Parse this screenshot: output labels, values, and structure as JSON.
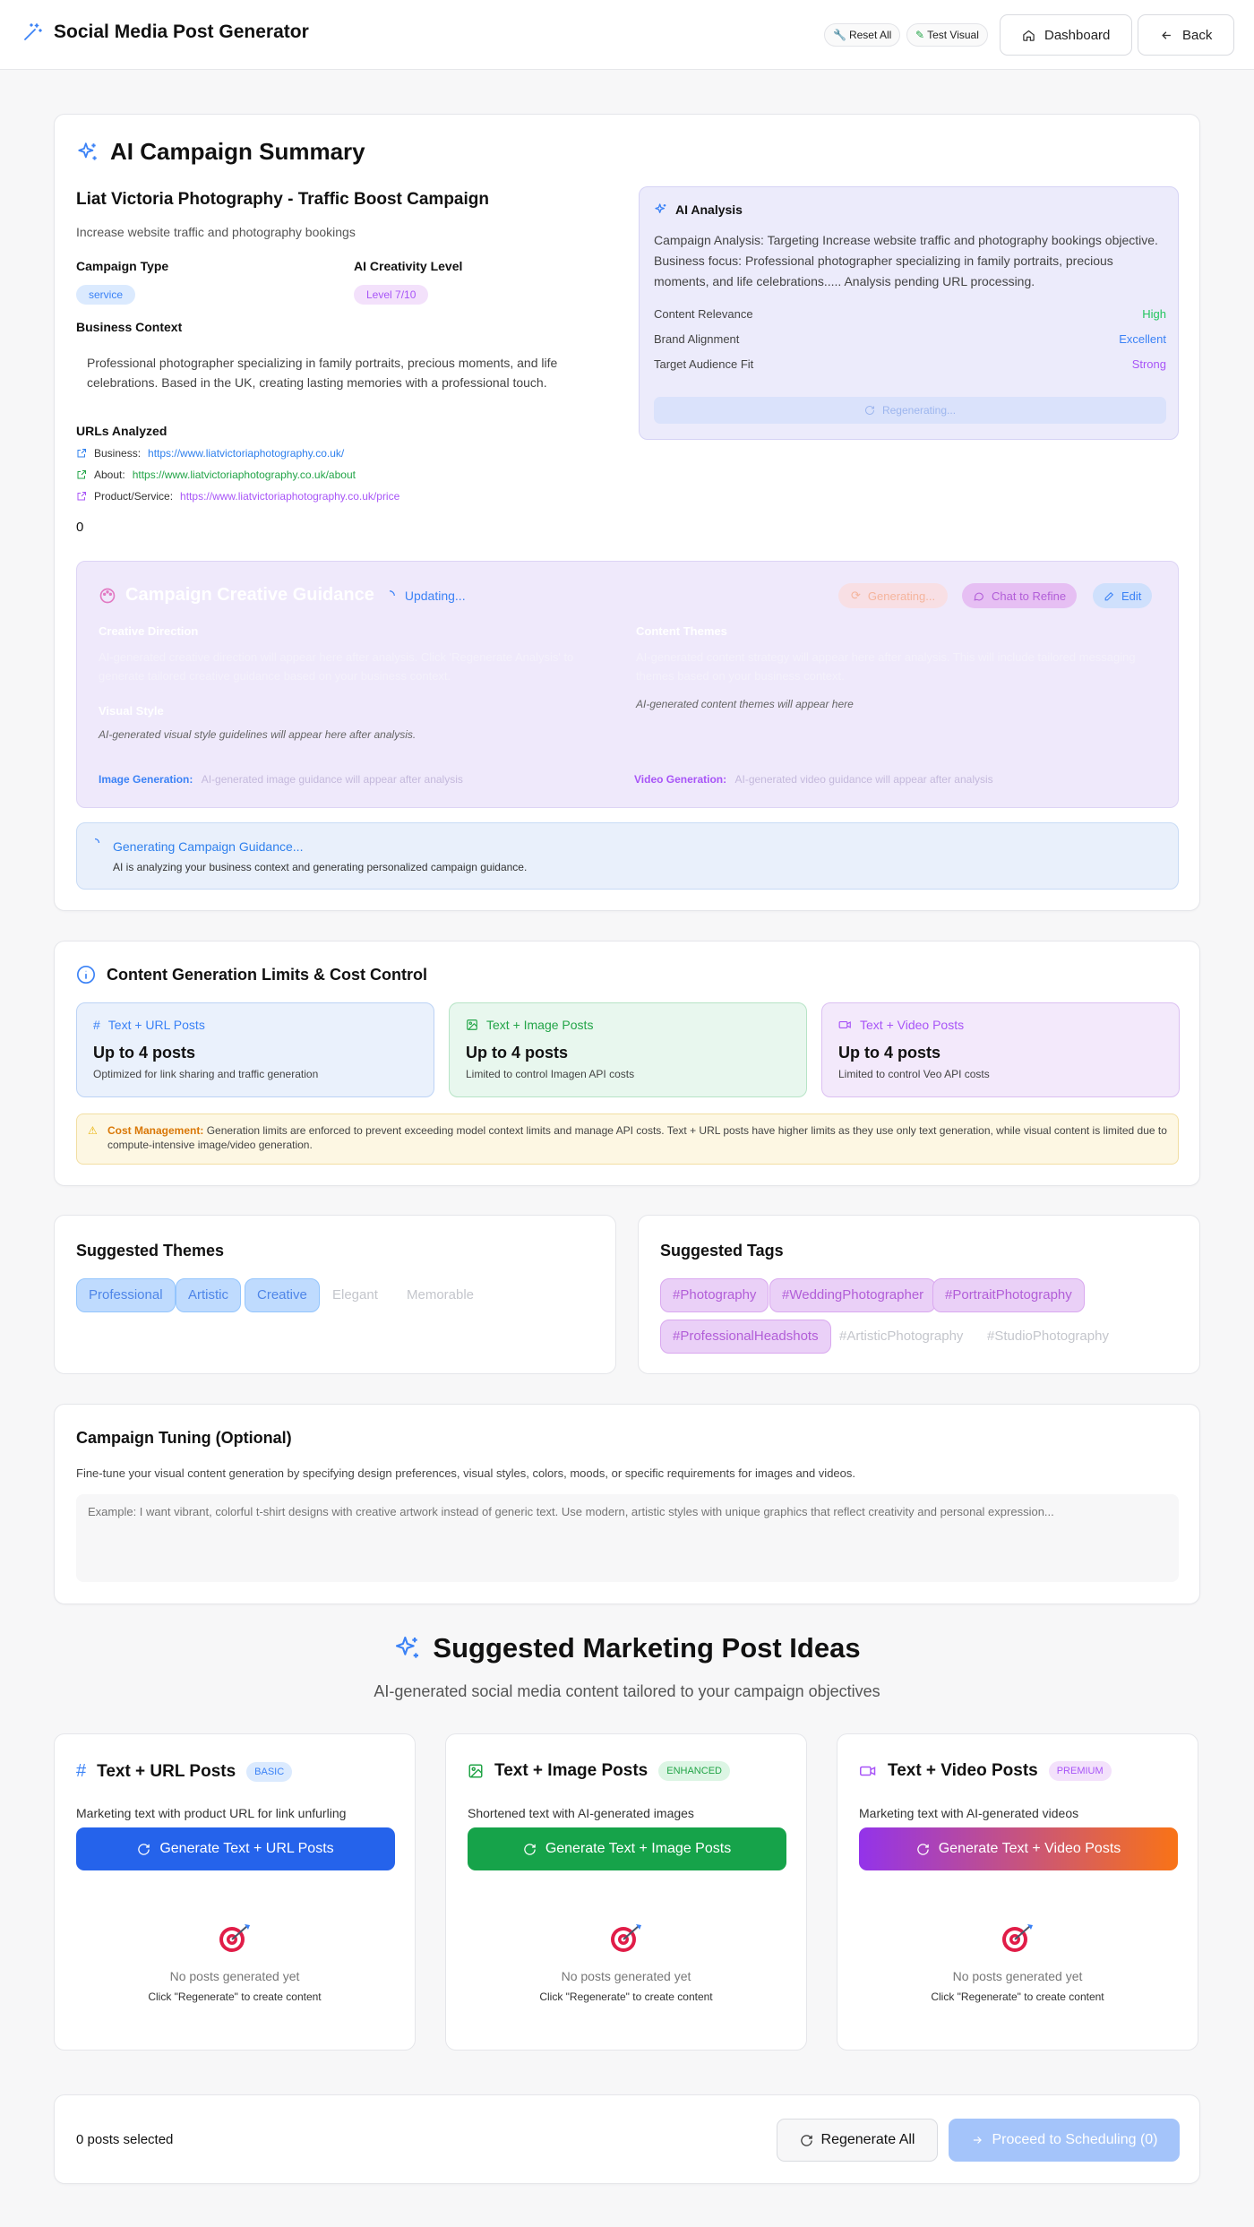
{
  "header": {
    "title": "Social Media Post Generator",
    "reset_label": "Reset All",
    "test_visual_label": "Test Visual",
    "dashboard_label": "Dashboard",
    "back_label": "Back"
  },
  "summary": {
    "title": "AI Campaign Summary",
    "campaign_name": "Liat Victoria Photography - Traffic Boost Campaign",
    "objective": "Increase website traffic and photography bookings",
    "campaign_type_label": "Campaign Type",
    "campaign_type_value": "service",
    "creativity_label": "AI Creativity Level",
    "creativity_value": "Level 7/10",
    "business_context_label": "Business Context",
    "business_context_text": "Professional photographer specializing in family portraits, precious moments, and life celebrations. Based in the UK, creating lasting memories with a professional touch.",
    "urls_label": "URLs Analyzed",
    "urls": [
      {
        "label": "Business:",
        "url": "https://www.liatvictoriaphotography.co.uk/",
        "color": "#2f80ed"
      },
      {
        "label": "About:",
        "url": "https://www.liatvictoriaphotography.co.uk/about",
        "color": "#22a447"
      },
      {
        "label": "Product/Service:",
        "url": "https://www.liatvictoriaphotography.co.uk/price",
        "color": "#a855f7"
      }
    ],
    "count": "0",
    "analysis": {
      "title": "AI Analysis",
      "text": "Campaign Analysis: Targeting Increase website traffic and photography bookings objective. Business focus: Professional photographer specializing in family portraits, precious moments, and life celebrations..... Analysis pending URL processing.",
      "metrics": [
        {
          "label": "Content Relevance",
          "value": "High",
          "color": "#22c55e"
        },
        {
          "label": "Brand Alignment",
          "value": "Excellent",
          "color": "#3b82f6"
        },
        {
          "label": "Target Audience Fit",
          "value": "Strong",
          "color": "#a855f7"
        }
      ],
      "regen_label": "Regenerating..."
    }
  },
  "guidance": {
    "title": "Campaign Creative Guidance",
    "updating": "Updating...",
    "generating_label": "Generating...",
    "chat_label": "Chat to Refine",
    "edit_label": "Edit",
    "creative_direction_title": "Creative Direction",
    "creative_direction_text": "AI-generated creative direction will appear here after analysis. Click 'Regenerate Analysis' to generate tailored creative guidance based on your business context.",
    "content_themes_title": "Content Themes",
    "content_themes_text": "AI-generated content strategy will appear here after analysis. This will include tailored messaging themes based on your business context.",
    "content_themes_placeholder": "AI-generated content themes will appear here",
    "visual_style_title": "Visual Style",
    "visual_style_text": "AI-generated visual style guidelines will appear here after analysis.",
    "image_gen_label": "Image Generation:",
    "image_gen_text": "AI-generated image guidance will appear after analysis",
    "video_gen_label": "Video Generation:",
    "video_gen_text": "AI-generated video guidance will appear after analysis",
    "status_title": "Generating Campaign Guidance...",
    "status_text": "AI is analyzing your business context and generating personalized campaign guidance."
  },
  "limits": {
    "title": "Content Generation Limits & Cost Control",
    "cards": [
      {
        "head": "Text + URL Posts",
        "title": "Up to 4 posts",
        "desc": "Optimized for link sharing and traffic generation"
      },
      {
        "head": "Text + Image Posts",
        "title": "Up to 4 posts",
        "desc": "Limited to control Imagen API costs"
      },
      {
        "head": "Text + Video Posts",
        "title": "Up to 4 posts",
        "desc": "Limited to control Veo API costs"
      }
    ],
    "notice_label": "Cost Management:",
    "notice_text": "Generation limits are enforced to prevent exceeding model context limits and manage API costs. Text + URL posts have higher limits as they use only text generation, while visual content is limited due to compute-intensive image/video generation."
  },
  "themes": {
    "title": "Suggested Themes",
    "items": [
      "Professional",
      "Artistic",
      "Creative",
      "Elegant",
      "Memorable"
    ]
  },
  "tags": {
    "title": "Suggested Tags",
    "items": [
      "#Photography",
      "#WeddingPhotographer",
      "#PortraitPhotography",
      "#ProfessionalHeadshots",
      "#ArtisticPhotography",
      "#StudioPhotography"
    ]
  },
  "tuning": {
    "title": "Campaign Tuning (Optional)",
    "desc": "Fine-tune your visual content generation by specifying design preferences, visual styles, colors, moods, or specific requirements for images and videos.",
    "placeholder": "Example: I want vibrant, colorful t-shirt designs with creative artwork instead of generic text. Use modern, artistic styles with unique graphics that reflect creativity and personal expression..."
  },
  "ideas": {
    "title": "Suggested Marketing Post Ideas",
    "subtitle": "AI-generated social media content tailored to your campaign objectives",
    "columns": [
      {
        "title": "Text + URL Posts",
        "badge": "BASIC",
        "desc": "Marketing text with product URL for link unfurling",
        "button": "Generate Text + URL Posts",
        "empty": "No posts generated yet",
        "hint": "Click \"Regenerate\" to create content"
      },
      {
        "title": "Text + Image Posts",
        "badge": "ENHANCED",
        "desc": "Shortened text with AI-generated images",
        "button": "Generate Text + Image Posts",
        "empty": "No posts generated yet",
        "hint": "Click \"Regenerate\" to create content"
      },
      {
        "title": "Text + Video Posts",
        "badge": "PREMIUM",
        "desc": "Marketing text with AI-generated videos",
        "button": "Generate Text + Video Posts",
        "empty": "No posts generated yet",
        "hint": "Click \"Regenerate\" to create content"
      }
    ]
  },
  "footer": {
    "selected": "0 posts selected",
    "regenerate_label": "Regenerate All",
    "proceed_label": "Proceed to Scheduling (0)"
  }
}
